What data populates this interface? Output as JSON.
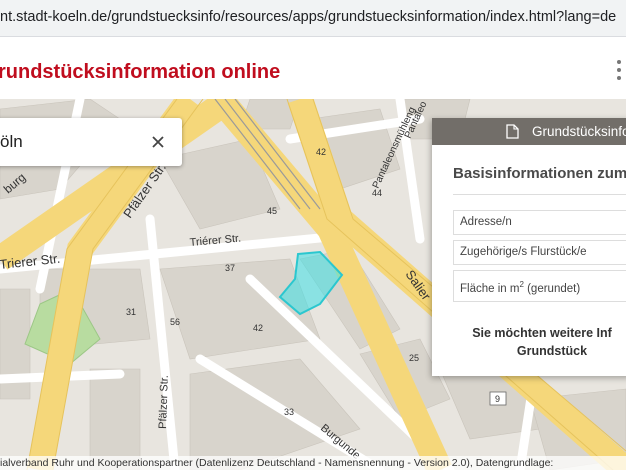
{
  "browser": {
    "url": "nt.stadt-koeln.de/grundstuecksinfo/resources/apps/grundstuecksinformation/index.html?lang=de"
  },
  "app": {
    "title": "rundstücksinformation online",
    "menu_icon": "vertical-dots-icon"
  },
  "search": {
    "value": "öln",
    "clear_icon": "close-icon"
  },
  "map": {
    "street_labels": [
      "Pfälzer Str.",
      "Triérer Str.",
      "Trierer Str.",
      "Pfälzer Str.",
      "Burgunde",
      "Salier",
      "Pantaleonsmühleng",
      "Pantaleo",
      "burg"
    ],
    "house_numbers": [
      "42",
      "44",
      "45",
      "37",
      "42",
      "56",
      "31",
      "33",
      "25",
      "9"
    ],
    "highlight_color": "#3de0e6"
  },
  "panel": {
    "header_title": "Grundstücksinfo",
    "header_icon": "document-icon",
    "heading": "Basisinformationen zum",
    "rows": [
      "Adresse/n",
      "Zugehörige/s Flurstück/e",
      "Fläche in m",
      "(gerundet)"
    ],
    "superscript": "2",
    "more_line1": "Sie möchten weitere Inf",
    "more_line2": "Grundstück"
  },
  "attribution": "ialverband Ruhr und Kooperationspartner (Datenlizenz Deutschland - Namensnennung - Version 2.0), Datengrundlage:"
}
